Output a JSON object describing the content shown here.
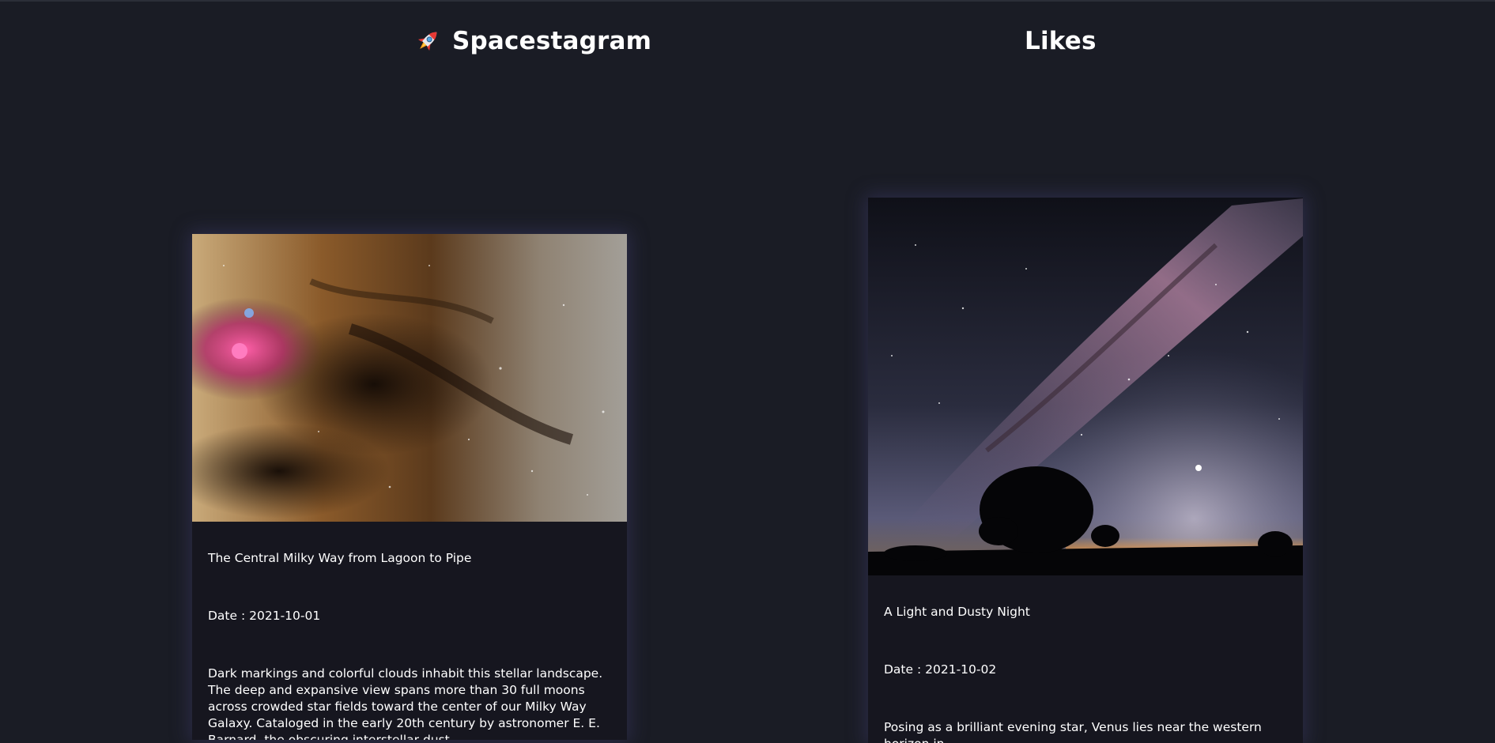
{
  "header": {
    "brand_title": "Spacestagram",
    "brand_icon": "rocket-icon",
    "likes_title": "Likes"
  },
  "colors": {
    "background": "#1a1c25",
    "card_background": "#16161f",
    "card_glow": "#403e6e",
    "text": "#ffffff"
  },
  "feed": {
    "items": [
      {
        "title": "The Central Milky Way from Lagoon to Pipe",
        "date": "Date : 2021-10-01",
        "description": "Dark markings and colorful clouds inhabit this stellar landscape. The deep and expansive view spans more than 30 full moons across crowded star fields toward the center of our Milky Way Galaxy. Cataloged in the early 20th century by astronomer E. E. Barnard, the obscuring interstellar dust"
      }
    ]
  },
  "likes": {
    "items": [
      {
        "title": "A Light and Dusty Night",
        "date": "Date : 2021-10-02",
        "description": "Posing as a brilliant evening star, Venus lies near the western horizon in"
      }
    ]
  }
}
